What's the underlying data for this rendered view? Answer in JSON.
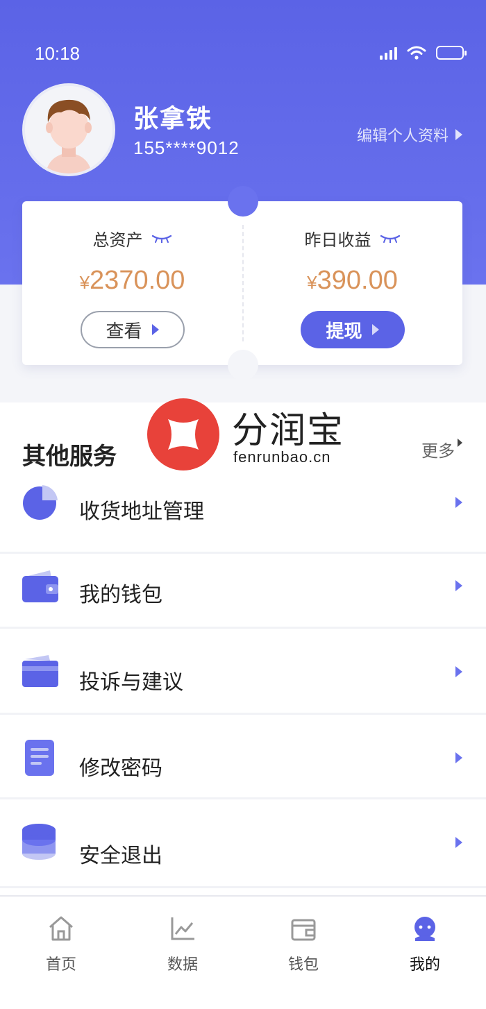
{
  "status_bar": {
    "time": "10:18"
  },
  "profile": {
    "name": "张拿铁",
    "phone": "155****9012",
    "edit_label": "编辑个人资料"
  },
  "assets": {
    "total": {
      "label": "总资产",
      "currency": "¥",
      "amount": "2370.00",
      "button": "查看"
    },
    "yesterday": {
      "label": "昨日收益",
      "currency": "¥",
      "amount": "390.00",
      "button": "提现"
    }
  },
  "services": {
    "title": "其他服务",
    "more": "更多",
    "items": [
      {
        "label": "收货地址管理",
        "icon": "pie-chart-icon"
      },
      {
        "label": "我的钱包",
        "icon": "wallet-icon"
      },
      {
        "label": "投诉与建议",
        "icon": "card-icon"
      },
      {
        "label": "修改密码",
        "icon": "document-icon"
      },
      {
        "label": "安全退出",
        "icon": "database-icon"
      }
    ]
  },
  "watermark": {
    "name": "分润宝",
    "url": "fenrunbao.cn"
  },
  "tabs": [
    {
      "label": "首页",
      "icon": "home-icon"
    },
    {
      "label": "数据",
      "icon": "chart-icon"
    },
    {
      "label": "钱包",
      "icon": "wallet-icon"
    },
    {
      "label": "我的",
      "icon": "profile-icon",
      "active": true
    }
  ],
  "colors": {
    "primary": "#5b63e6",
    "amount": "#d9935a",
    "logo": "#e8423a"
  }
}
